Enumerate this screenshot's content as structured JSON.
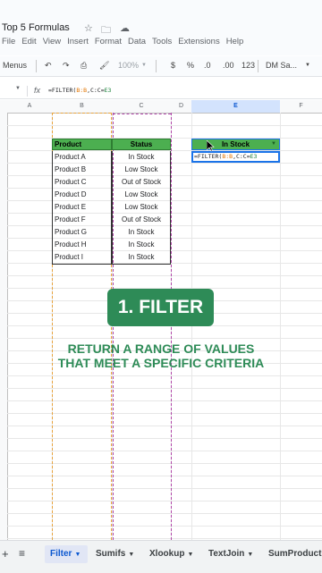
{
  "app": {
    "doc_title": "Top 5 Formulas",
    "menu": [
      "File",
      "Edit",
      "View",
      "Insert",
      "Format",
      "Data",
      "Tools",
      "Extensions",
      "Help"
    ]
  },
  "toolbar": {
    "menus_label": "Menus",
    "zoom": "100%",
    "currency": "$",
    "percent": "%",
    "dec_decrease": ".0",
    "dec_increase": ".00",
    "number_format": "123",
    "font_name": "DM Sa..."
  },
  "formula_bar": {
    "fx": "fx",
    "prefix": "=FILTER(",
    "arg1": "B:B",
    "mid": ",C:C=",
    "arg2": "E3"
  },
  "columns": [
    {
      "label": "A",
      "name": "col-a"
    },
    {
      "label": "B",
      "name": "col-b"
    },
    {
      "label": "C",
      "name": "col-c"
    },
    {
      "label": "D",
      "name": "col-d"
    },
    {
      "label": "E",
      "name": "col-e"
    },
    {
      "label": "F",
      "name": "col-f"
    }
  ],
  "table": {
    "headers": {
      "product": "Product",
      "status": "Status"
    },
    "rows": [
      {
        "product": "Product A",
        "status": "In Stock"
      },
      {
        "product": "Product B",
        "status": "Low Stock"
      },
      {
        "product": "Product C",
        "status": "Out of Stock"
      },
      {
        "product": "Product D",
        "status": "Low Stock"
      },
      {
        "product": "Product E",
        "status": "Low Stock"
      },
      {
        "product": "Product F",
        "status": "Out of Stock"
      },
      {
        "product": "Product G",
        "status": "In Stock"
      },
      {
        "product": "Product H",
        "status": "In Stock"
      },
      {
        "product": "Product I",
        "status": "In Stock"
      }
    ]
  },
  "filter_cell": {
    "header": "In Stock",
    "formula_prefix": "=FILTER(",
    "formula_arg1": "B:B",
    "formula_mid": ",C:C=",
    "formula_arg2": "E3"
  },
  "overlay": {
    "badge": "1. FILTER",
    "line1": "RETURN A RANGE OF VALUES",
    "line2": "THAT MEET A SPECIFIC CRITERIA"
  },
  "sheet_tabs": [
    {
      "label": "Filter",
      "active": true
    },
    {
      "label": "Sumifs",
      "active": false
    },
    {
      "label": "Xlookup",
      "active": false
    },
    {
      "label": "TextJoin",
      "active": false
    },
    {
      "label": "SumProduct",
      "active": false
    }
  ],
  "colors": {
    "header_green": "#4caf50",
    "accent_blue": "#1a73e8",
    "overlay_green": "#2e8b57",
    "range_orange": "#e8a33b",
    "range_purple": "#b046a8"
  }
}
